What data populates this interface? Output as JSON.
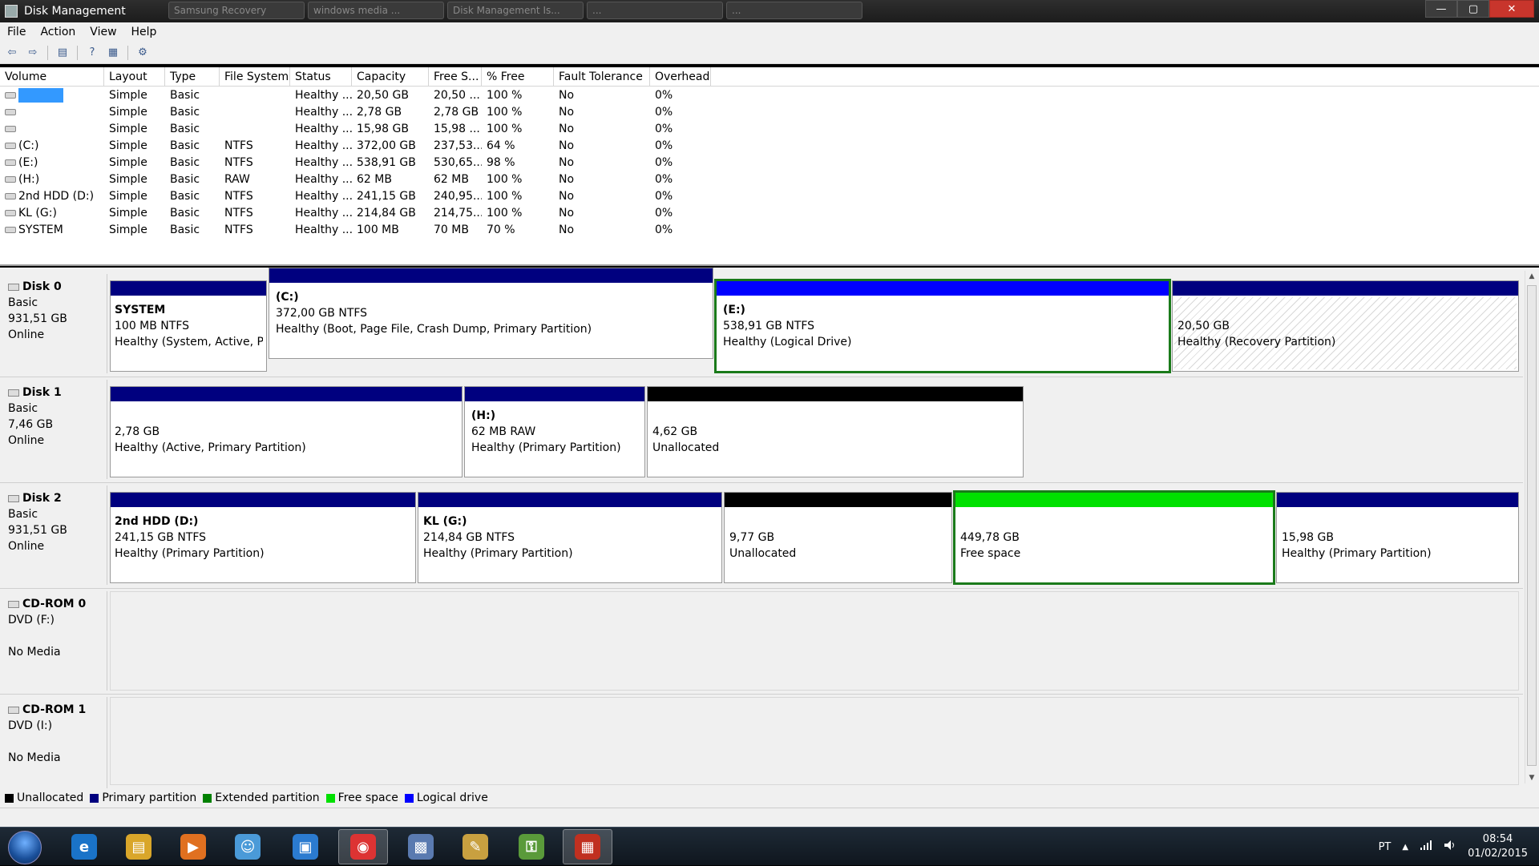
{
  "window": {
    "title": "Disk Management",
    "bg_tabs": [
      "Samsung Recovery",
      "windows media ...",
      "Disk Management Is...",
      "...",
      "..."
    ]
  },
  "window_buttons": {
    "minimize": "—",
    "maximize": "▢",
    "close": "✕"
  },
  "menu": [
    "File",
    "Action",
    "View",
    "Help"
  ],
  "toolbar": {
    "icons": [
      "back-arrow-icon",
      "forward-arrow-icon",
      "show-hide-console-tree-icon",
      "help-icon",
      "properties-icon",
      "settings-icon"
    ],
    "glyphs": [
      "⇦",
      "⇨",
      "▤",
      "?",
      "▦",
      "⚙"
    ]
  },
  "volume_list": {
    "columns": [
      "Volume",
      "Layout",
      "Type",
      "File System",
      "Status",
      "Capacity",
      "Free S...",
      "% Free",
      "Fault Tolerance",
      "Overhead"
    ],
    "rows": [
      {
        "volume": "",
        "selected": true,
        "layout": "Simple",
        "type": "Basic",
        "fs": "",
        "status": "Healthy ...",
        "capacity": "20,50 GB",
        "free": "20,50 ...",
        "pct": "100 %",
        "fault": "No",
        "overhead": "0%"
      },
      {
        "volume": "",
        "layout": "Simple",
        "type": "Basic",
        "fs": "",
        "status": "Healthy ...",
        "capacity": "2,78 GB",
        "free": "2,78 GB",
        "pct": "100 %",
        "fault": "No",
        "overhead": "0%"
      },
      {
        "volume": "",
        "layout": "Simple",
        "type": "Basic",
        "fs": "",
        "status": "Healthy ...",
        "capacity": "15,98 GB",
        "free": "15,98 ...",
        "pct": "100 %",
        "fault": "No",
        "overhead": "0%"
      },
      {
        "volume": "(C:)",
        "layout": "Simple",
        "type": "Basic",
        "fs": "NTFS",
        "status": "Healthy ...",
        "capacity": "372,00 GB",
        "free": "237,53...",
        "pct": "64 %",
        "fault": "No",
        "overhead": "0%"
      },
      {
        "volume": "(E:)",
        "layout": "Simple",
        "type": "Basic",
        "fs": "NTFS",
        "status": "Healthy ...",
        "capacity": "538,91 GB",
        "free": "530,65...",
        "pct": "98 %",
        "fault": "No",
        "overhead": "0%"
      },
      {
        "volume": "(H:)",
        "layout": "Simple",
        "type": "Basic",
        "fs": "RAW",
        "status": "Healthy ...",
        "capacity": "62 MB",
        "free": "62 MB",
        "pct": "100 %",
        "fault": "No",
        "overhead": "0%"
      },
      {
        "volume": "2nd HDD (D:)",
        "layout": "Simple",
        "type": "Basic",
        "fs": "NTFS",
        "status": "Healthy ...",
        "capacity": "241,15 GB",
        "free": "240,95...",
        "pct": "100 %",
        "fault": "No",
        "overhead": "0%"
      },
      {
        "volume": "KL (G:)",
        "layout": "Simple",
        "type": "Basic",
        "fs": "NTFS",
        "status": "Healthy ...",
        "capacity": "214,84 GB",
        "free": "214,75...",
        "pct": "100 %",
        "fault": "No",
        "overhead": "0%"
      },
      {
        "volume": "SYSTEM",
        "layout": "Simple",
        "type": "Basic",
        "fs": "NTFS",
        "status": "Healthy ...",
        "capacity": "100 MB",
        "free": "70 MB",
        "pct": "70 %",
        "fault": "No",
        "overhead": "0%"
      }
    ]
  },
  "disks": [
    {
      "name": "Disk 0",
      "kind": "Basic",
      "size": "931,51 GB",
      "state": "Online",
      "partitions": [
        {
          "name": "SYSTEM",
          "info": "100 MB NTFS",
          "status": "Healthy (System, Active, Prir",
          "bar": "#00007f"
        },
        {
          "name": "(C:)",
          "info": "372,00 GB NTFS",
          "status": "Healthy (Boot, Page File, Crash Dump, Primary Partition)",
          "bar": "#00007f"
        },
        {
          "name": "(E:)",
          "info": "538,91 GB NTFS",
          "status": "Healthy (Logical Drive)",
          "bar": "#0000ff",
          "selected": true
        },
        {
          "name": "",
          "info": "20,50 GB",
          "status": "Healthy (Recovery Partition)",
          "bar": "#00007f",
          "hatched": true
        }
      ]
    },
    {
      "name": "Disk 1",
      "kind": "Basic",
      "size": "7,46 GB",
      "state": "Online",
      "partitions": [
        {
          "name": "",
          "info": "2,78 GB",
          "status": "Healthy (Active, Primary Partition)",
          "bar": "#00007f"
        },
        {
          "name": "(H:)",
          "info": "62 MB RAW",
          "status": "Healthy (Primary Partition)",
          "bar": "#00007f"
        },
        {
          "name": "",
          "info": "4,62 GB",
          "status": "Unallocated",
          "bar": "#000000"
        }
      ]
    },
    {
      "name": "Disk 2",
      "kind": "Basic",
      "size": "931,51 GB",
      "state": "Online",
      "partitions": [
        {
          "name": "2nd HDD  (D:)",
          "info": "241,15 GB NTFS",
          "status": "Healthy (Primary Partition)",
          "bar": "#00007f"
        },
        {
          "name": "KL  (G:)",
          "info": "214,84 GB NTFS",
          "status": "Healthy (Primary Partition)",
          "bar": "#00007f"
        },
        {
          "name": "",
          "info": "9,77 GB",
          "status": "Unallocated",
          "bar": "#000000"
        },
        {
          "name": "",
          "info": "449,78 GB",
          "status": "Free space",
          "bar": "#00e000",
          "selected": true
        },
        {
          "name": "",
          "info": "15,98 GB",
          "status": "Healthy (Primary Partition)",
          "bar": "#00007f"
        }
      ]
    }
  ],
  "cdroms": [
    {
      "name": "CD-ROM 0",
      "drive": "DVD (F:)",
      "media": "No Media"
    },
    {
      "name": "CD-ROM 1",
      "drive": "DVD (I:)",
      "media": "No Media"
    }
  ],
  "legend": [
    {
      "label": "Unallocated",
      "color": "#000000"
    },
    {
      "label": "Primary partition",
      "color": "#00007f"
    },
    {
      "label": "Extended partition",
      "color": "#008000"
    },
    {
      "label": "Free space",
      "color": "#00e000"
    },
    {
      "label": "Logical drive",
      "color": "#0000ff"
    }
  ],
  "taskbar": {
    "apps": [
      {
        "name": "internet-explorer",
        "glyph": "e",
        "color": "#1a73c8"
      },
      {
        "name": "file-explorer",
        "glyph": "▤",
        "color": "#d9a62a"
      },
      {
        "name": "media-player",
        "glyph": "▶",
        "color": "#e07020"
      },
      {
        "name": "people",
        "glyph": "☺",
        "color": "#4a9ad8"
      },
      {
        "name": "network-folder",
        "glyph": "▣",
        "color": "#2b7bd0"
      },
      {
        "name": "chrome",
        "glyph": "◉",
        "color": "#d33",
        "active": true
      },
      {
        "name": "virtualbox",
        "glyph": "▩",
        "color": "#5a7ab0"
      },
      {
        "name": "paint",
        "glyph": "✎",
        "color": "#c8a040"
      },
      {
        "name": "security-lock",
        "glyph": "⚿",
        "color": "#5a9a3a"
      },
      {
        "name": "toolbox",
        "glyph": "▦",
        "color": "#c03020",
        "active": true
      }
    ],
    "tray": {
      "lang": "PT",
      "up_arrow": "▲",
      "time": "08:54",
      "date": "01/02/2015"
    }
  }
}
